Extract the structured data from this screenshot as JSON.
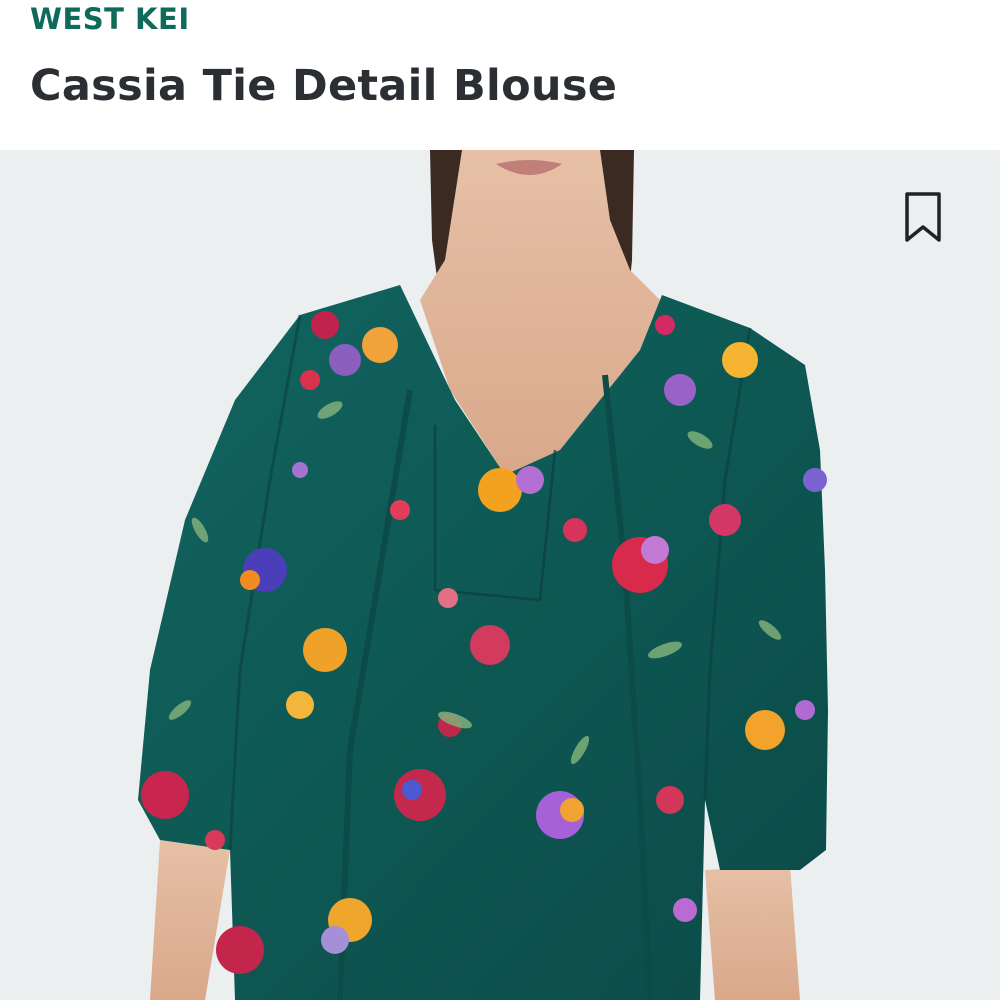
{
  "product": {
    "brand": "WEST KEI",
    "title": "Cassia Tie Detail Blouse"
  },
  "image": {
    "subject": "model-wearing-floral-blouse",
    "background_color": "#eceff0",
    "garment_color": "#0e5a55",
    "skin_color": "#e2b89e",
    "hair_color": "#3a2b24"
  },
  "actions": {
    "bookmark_icon": "bookmark-icon"
  },
  "colors": {
    "brand_accent": "#0e6a5b",
    "title_text": "#2b2f33"
  }
}
